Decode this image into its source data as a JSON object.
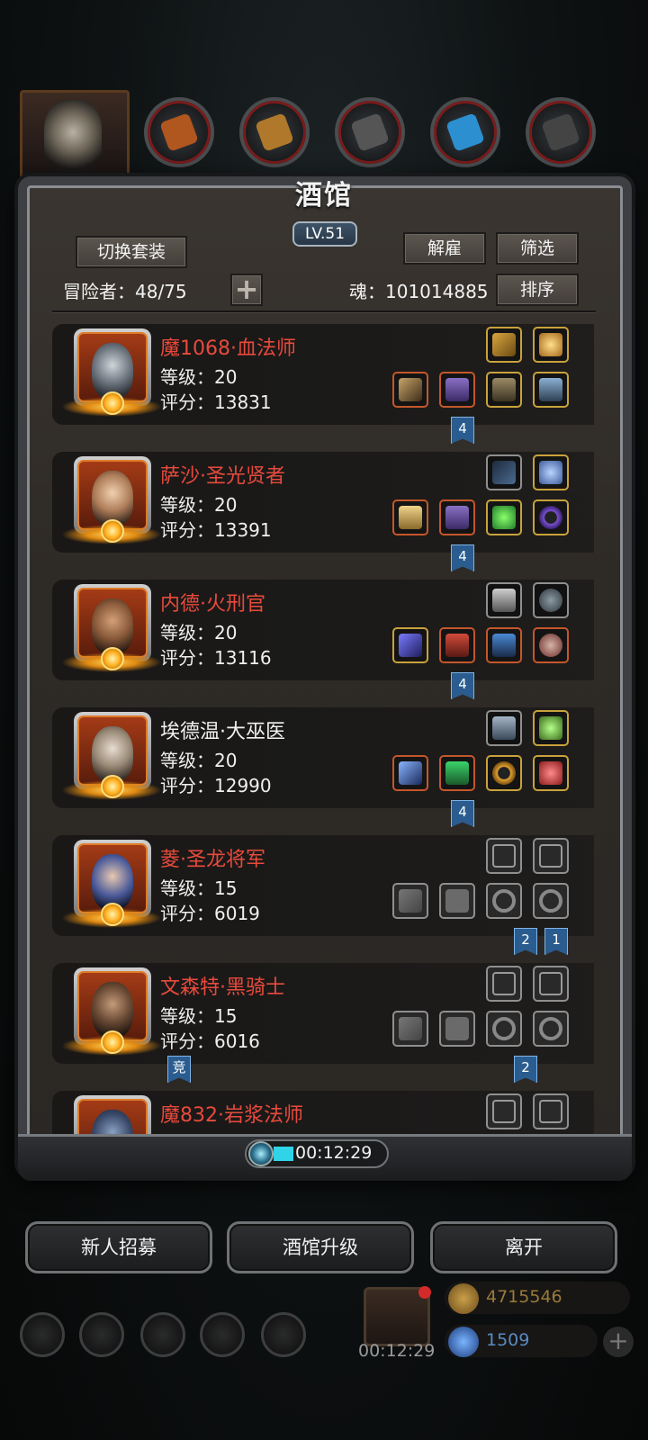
{
  "header": {
    "title": "酒馆",
    "level": "LV.51"
  },
  "toolbar": {
    "switch_set": "切换套装",
    "dismiss": "解雇",
    "filter": "筛选",
    "sort": "排序",
    "add": "+"
  },
  "stats": {
    "adventurers_label": "冒险者：48/75",
    "soul_label": "魂：101014885"
  },
  "heroes": [
    {
      "name": "魔1068·血法师",
      "level": "等级：20",
      "score": "评分：13831",
      "name_color": "red",
      "tags": [
        "4"
      ]
    },
    {
      "name": "萨沙·圣光贤者",
      "level": "等级：20",
      "score": "评分：13391",
      "name_color": "red",
      "tags": [
        "4"
      ]
    },
    {
      "name": "内德·火刑官",
      "level": "等级：20",
      "score": "评分：13116",
      "name_color": "red",
      "tags": [
        "4"
      ]
    },
    {
      "name": "埃德温·大巫医",
      "level": "等级：20",
      "score": "评分：12990",
      "name_color": "white",
      "tags": [
        "4"
      ]
    },
    {
      "name": "菱·圣龙将军",
      "level": "等级：15",
      "score": "评分：6019",
      "name_color": "red",
      "tags": [
        "2",
        "1"
      ]
    },
    {
      "name": "文森特·黑骑士",
      "level": "等级：15",
      "score": "评分：6016",
      "name_color": "red",
      "tags": [
        "2"
      ],
      "badge": "竞"
    },
    {
      "name": "魔832·岩浆法师",
      "level": "",
      "score": "",
      "name_color": "red",
      "tags": []
    }
  ],
  "timer": {
    "value": "00:12:29"
  },
  "buttons": {
    "recruit": "新人招募",
    "upgrade": "酒馆升级",
    "leave": "离开"
  },
  "resources": {
    "gold": "4715546",
    "gems": "1509",
    "gift_timer": "00:12:29"
  },
  "colors": {
    "name_red": "#e84a3c",
    "tag_blue": "#2a5c8f",
    "panel_bg": "#2e2a26"
  }
}
